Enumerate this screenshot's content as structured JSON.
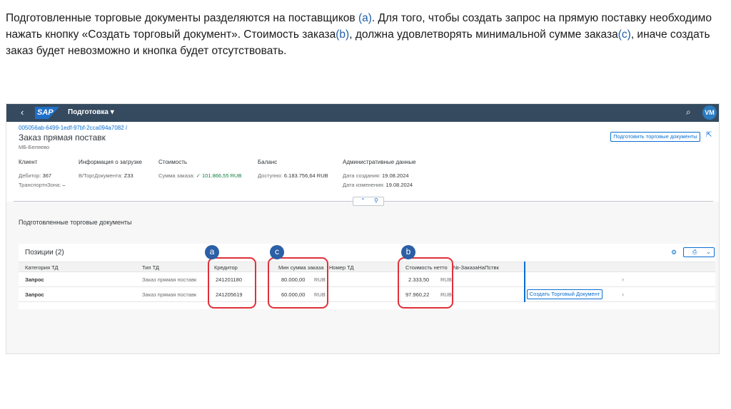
{
  "intro": {
    "p1": "Подготовленные торговые документы разделяются на поставщиков ",
    "mark_a": "(a)",
    "p2": ". Для того, чтобы создать запрос на прямую поставку необходимо нажать кнопку «Создать торговый документ». Стоимость заказа",
    "mark_b": "(b)",
    "p3": ", должна удовлетворять минимальной сумме заказа",
    "mark_c": "(c)",
    "p4": ", иначе создать заказ будет невозможно и кнопка будет отсутствовать."
  },
  "shell": {
    "back_icon": "‹",
    "logo": "SAP",
    "title": "Подготовка ▾",
    "search_icon": "⌕",
    "avatar": "VM"
  },
  "header": {
    "id_link": "005056ab-6499-1edf-97bf-2cca094a7082 /",
    "title": "Заказ прямая поставк",
    "subtitle": "МБ-Беляево",
    "prepare_button": "Подготовить торговые документы",
    "share_icon": "⇱",
    "client": {
      "heading": "Клиент",
      "l1": "Дебитор:",
      "v1": "367",
      "l2": "ТранспортнЗона:",
      "v2": "–"
    },
    "load": {
      "heading": "Информация о загрузке",
      "l1": "В/ТоргДокумента:",
      "v1": "Z33"
    },
    "cost": {
      "heading": "Стоимость",
      "l1": "Сумма заказа:",
      "v1": "101.866,55",
      "unit": "RUB",
      "status_icon": "✓"
    },
    "balance": {
      "heading": "Баланс",
      "l1": "Доступно:",
      "v1": "6.183.756,64",
      "unit": "RUB"
    },
    "admin": {
      "heading": "Административные данные",
      "l1": "Дата создания:",
      "v1": "19.08.2024",
      "l2": "Дата изменения:",
      "v2": "19.08.2024"
    },
    "collapse_icon": "⌃",
    "pin_icon": "⚲"
  },
  "section_title": "Подготовленные торговые документы",
  "table": {
    "title": "Позиции (2)",
    "settings_icon": "⚙",
    "export_icon": "⎙",
    "export_dropdown": "⌄",
    "columns": [
      "Категория ТД",
      "Тип ТД",
      "Кредитор",
      "Мин сумма заказа",
      "Номер ТД",
      "Стоимость нетто",
      "№-ЗаказаНаПствк"
    ],
    "rows": [
      {
        "category": "Запрос",
        "type": "Заказ прямая поставк",
        "creditor": "241201180",
        "min_sum": "80.000,00",
        "min_unit": "RUB",
        "doc_no": "",
        "net_value": "2.333,50",
        "net_unit": "RUB",
        "order_no": "",
        "action": "",
        "nav": "›"
      },
      {
        "category": "Запрос",
        "type": "Заказ прямая поставк",
        "creditor": "241205619",
        "min_sum": "60.000,00",
        "min_unit": "RUB",
        "doc_no": "",
        "net_value": "97.960,22",
        "net_unit": "RUB",
        "order_no": "",
        "action": "Создать Торговый Документ",
        "nav": "›"
      }
    ]
  },
  "annotations": {
    "a": "a",
    "b": "b",
    "c": "c"
  },
  "colors": {
    "shell": "#354a5f",
    "accent": "#0a6ed1",
    "annotation_ring": "#e0303a",
    "annotation_badge": "#2b5fa6",
    "positive": "#107e3e"
  }
}
